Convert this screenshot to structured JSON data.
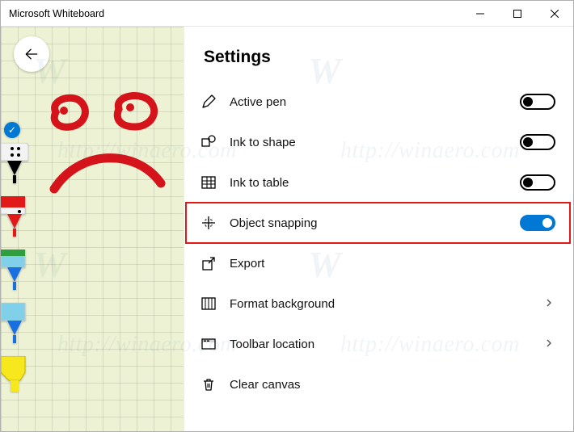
{
  "window": {
    "title": "Microsoft Whiteboard"
  },
  "watermark": {
    "w_label": "W",
    "url_label": "http://winaero.com"
  },
  "settings": {
    "heading": "Settings",
    "items": [
      {
        "label": "Active pen",
        "kind": "toggle",
        "on": true
      },
      {
        "label": "Ink to shape",
        "kind": "toggle",
        "on": true
      },
      {
        "label": "Ink to table",
        "kind": "toggle",
        "on": true
      },
      {
        "label": "Object snapping",
        "kind": "toggle",
        "on": true,
        "highlighted": true,
        "blue": true
      },
      {
        "label": "Export",
        "kind": "action"
      },
      {
        "label": "Format background",
        "kind": "nav"
      },
      {
        "label": "Toolbar location",
        "kind": "nav"
      },
      {
        "label": "Clear canvas",
        "kind": "action"
      }
    ]
  },
  "toolbar": {
    "selected_indicator": "✓",
    "pens": [
      {
        "name": "black-pen",
        "color": "#000000"
      },
      {
        "name": "red-pen",
        "color": "#e11919"
      },
      {
        "name": "green-pen",
        "color": "#2e9e3f"
      },
      {
        "name": "blue-pen",
        "color": "#1a6fe0"
      },
      {
        "name": "highlighter",
        "color": "#f7e71d"
      }
    ]
  }
}
